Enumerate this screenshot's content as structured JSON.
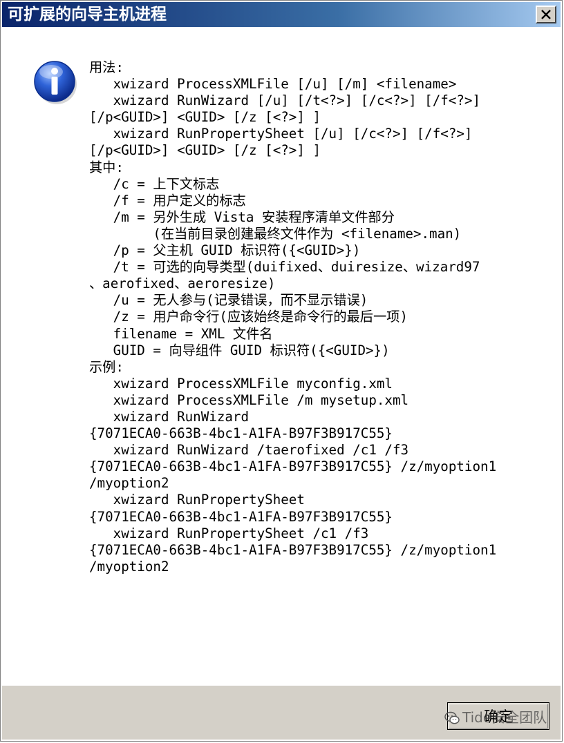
{
  "window": {
    "title": "可扩展的向导主机进程",
    "close_glyph": "✕"
  },
  "icon": {
    "name": "info-icon",
    "glyph": "i",
    "color": "#2a56c6"
  },
  "message": {
    "lines": [
      "用法:",
      "   xwizard ProcessXMLFile [/u] [/m] <filename>",
      "   xwizard RunWizard [/u] [/t<?>] [/c<?>] [/f<?>]",
      "[/p<GUID>] <GUID> [/z [<?>] ]",
      "   xwizard RunPropertySheet [/u] [/c<?>] [/f<?>]",
      "[/p<GUID>] <GUID> [/z [<?>] ]",
      "其中:",
      "   /c = 上下文标志",
      "   /f = 用户定义的标志",
      "   /m = 另外生成 Vista 安装程序清单文件部分",
      "        (在当前目录创建最终文件作为 <filename>.man)",
      "   /p = 父主机 GUID 标识符({<GUID>})",
      "   /t = 可选的向导类型(duifixed、duiresize、wizard97",
      "、aerofixed、aeroresize)",
      "   /u = 无人参与(记录错误，而不显示错误)",
      "   /z = 用户命令行(应该始终是命令行的最后一项)",
      "   filename = XML 文件名",
      "   GUID = 向导组件 GUID 标识符({<GUID>})",
      "示例:",
      "   xwizard ProcessXMLFile myconfig.xml",
      "   xwizard ProcessXMLFile /m mysetup.xml",
      "   xwizard RunWizard",
      "{7071ECA0-663B-4bc1-A1FA-B97F3B917C55}",
      "   xwizard RunWizard /taerofixed /c1 /f3",
      "{7071ECA0-663B-4bc1-A1FA-B97F3B917C55} /z/myoption1",
      "/myoption2",
      "   xwizard RunPropertySheet",
      "{7071ECA0-663B-4bc1-A1FA-B97F3B917C55}",
      "   xwizard RunPropertySheet /c1 /f3",
      "{7071ECA0-663B-4bc1-A1FA-B97F3B917C55} /z/myoption1",
      "/myoption2"
    ]
  },
  "footer": {
    "ok_label": "确定",
    "watermark": "Tide安全团队"
  },
  "colors": {
    "titlebar_start": "#0a246a",
    "titlebar_end": "#a6caf0",
    "footer_bg": "#d4d0c8"
  }
}
